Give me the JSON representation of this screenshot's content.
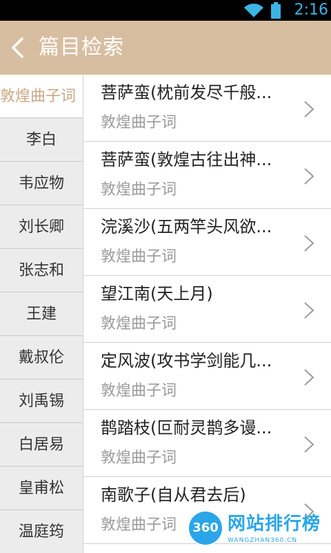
{
  "statusbar": {
    "time": "2:16"
  },
  "header": {
    "title": "篇目检索"
  },
  "sidebar": {
    "items": [
      {
        "label": "敦煌曲子词"
      },
      {
        "label": "李白"
      },
      {
        "label": "韦应物"
      },
      {
        "label": "刘长卿"
      },
      {
        "label": "张志和"
      },
      {
        "label": "王建"
      },
      {
        "label": "戴叔伦"
      },
      {
        "label": "刘禹锡"
      },
      {
        "label": "白居易"
      },
      {
        "label": "皇甫松"
      },
      {
        "label": "温庭筠"
      }
    ]
  },
  "list": {
    "rows": [
      {
        "title": "菩萨蛮(枕前发尽千般...",
        "subtitle": "敦煌曲子词"
      },
      {
        "title": "菩萨蛮(敦煌古往出神...",
        "subtitle": "敦煌曲子词"
      },
      {
        "title": "浣溪沙(五两竿头风欲...",
        "subtitle": "敦煌曲子词"
      },
      {
        "title": "望江南(天上月)",
        "subtitle": "敦煌曲子词"
      },
      {
        "title": "定风波(攻书学剑能几...",
        "subtitle": "敦煌曲子词"
      },
      {
        "title": "鹊踏枝(叵耐灵鹊多谩...",
        "subtitle": "敦煌曲子词"
      },
      {
        "title": "南歌子(自从君去后)",
        "subtitle": "敦煌曲子词"
      }
    ]
  },
  "watermark": {
    "badge": "360",
    "brand": "网站排行榜",
    "domain": "WANGZHAN360.CN"
  },
  "colors": {
    "header": "#d8bea0",
    "accent": "#c8a886",
    "status_icon": "#3cb4e6"
  }
}
